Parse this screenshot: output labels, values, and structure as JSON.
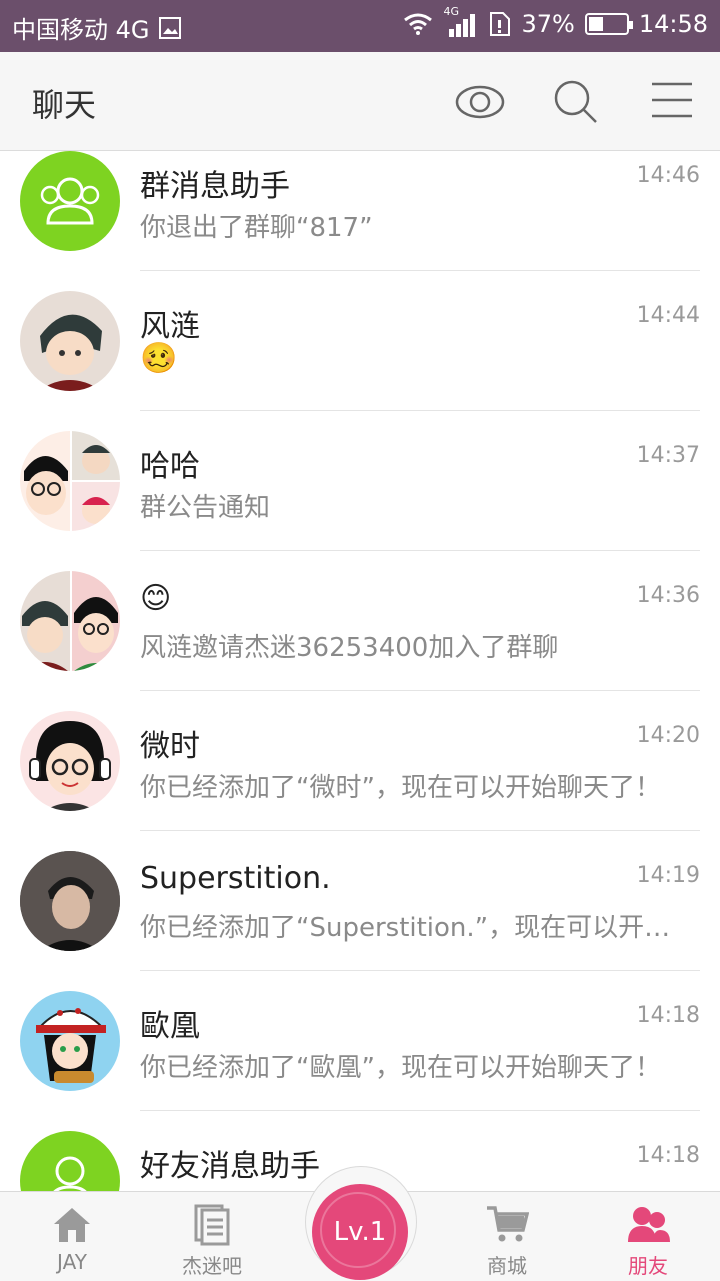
{
  "status_bar": {
    "carrier": "中国移动 4G",
    "network_badge": "4G",
    "battery_percent": "37%",
    "battery_level": 0.37,
    "time": "14:58"
  },
  "header": {
    "title": "聊天",
    "icons": [
      "eye-icon",
      "search-icon",
      "menu-icon"
    ]
  },
  "colors": {
    "accent_pink": "#e4487a",
    "green_avatar": "#7ed321",
    "status_bar_bg": "#6b4f6b"
  },
  "chats": [
    {
      "name": "群消息助手",
      "message": "你退出了群聊“817”",
      "time": "14:46",
      "avatar": "group-assistant-icon"
    },
    {
      "name": "风涟",
      "message": "",
      "emoji": "🥴",
      "time": "14:44",
      "avatar": "cartoon-boy-avatar"
    },
    {
      "name": "哈哈",
      "message": "群公告通知",
      "time": "14:37",
      "avatar": "group-collage-avatar"
    },
    {
      "name": "",
      "name_emoji": "😊",
      "message": "风涟邀请杰迷36253400加入了群聊",
      "time": "14:36",
      "avatar": "group-pair-avatar"
    },
    {
      "name": "微时",
      "message": "你已经添加了“微时”，现在可以开始聊天了！",
      "time": "14:20",
      "avatar": "headphone-girl-avatar"
    },
    {
      "name": "Superstition.",
      "message": "你已经添加了“Superstition.”，现在可以开…",
      "time": "14:19",
      "avatar": "photo-boy-avatar"
    },
    {
      "name": "歐凰",
      "message": "你已经添加了“歐凰”，现在可以开始聊天了！",
      "time": "14:18",
      "avatar": "cap-cartoon-avatar"
    },
    {
      "name": "好友消息助手",
      "message": "",
      "time": "14:18",
      "avatar": "friend-assistant-icon"
    }
  ],
  "tabbar": {
    "tabs": [
      {
        "label": "JAY",
        "icon": "home-icon",
        "active": false
      },
      {
        "label": "杰迷吧",
        "icon": "forum-icon",
        "active": false
      },
      {
        "label": "商城",
        "icon": "cart-icon",
        "active": false
      },
      {
        "label": "朋友",
        "icon": "friends-icon",
        "active": true
      }
    ],
    "level_button": "Lv.1"
  }
}
